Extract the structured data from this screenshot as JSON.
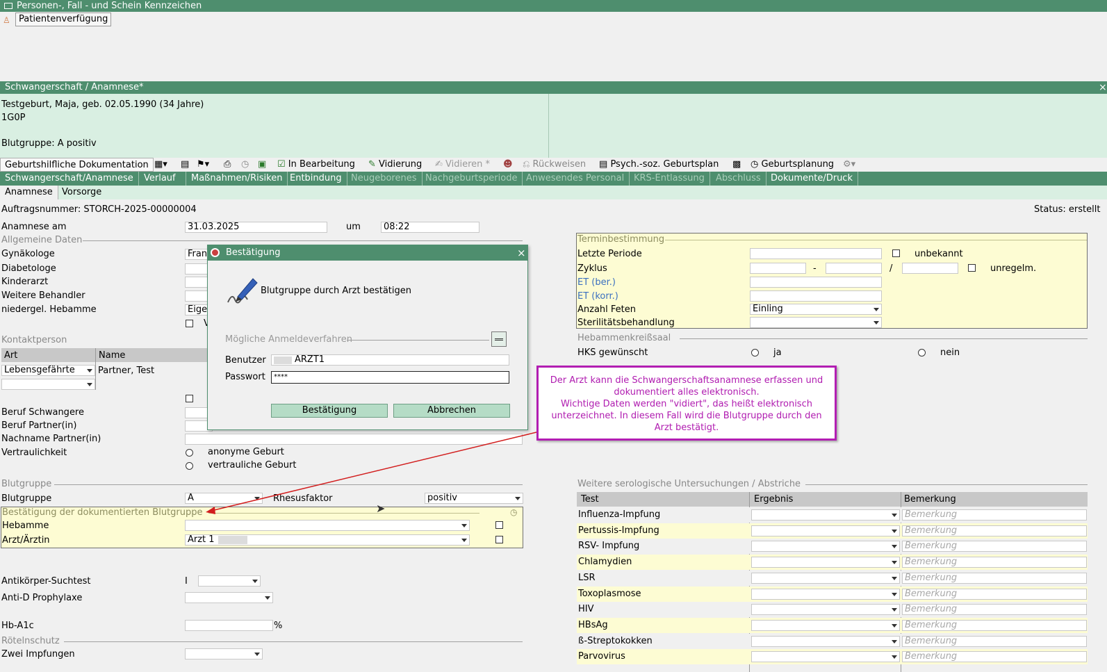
{
  "top_bar": {
    "title": "Personen-, Fall - und Schein Kennzeichen",
    "item": "Patientenverfügung"
  },
  "window": {
    "title": "Schwangerschaft / Anamnese*",
    "close": "×"
  },
  "patient": {
    "line1": "Testgeburt, Maja, geb. 02.05.1990 (34 Jahre)",
    "line2": "1G0P",
    "line3": "Blutgruppe: A positiv"
  },
  "toolbar": {
    "title": "Geburtshilfliche Dokumentation",
    "in_bearbeitung": "In Bearbeitung",
    "vidierung": "Vidierung",
    "vidieren": "Vidieren *",
    "rueckweisen": "Rückweisen",
    "psych": "Psych.-soz. Geburtsplan",
    "geburtsplanung": "Geburtsplanung"
  },
  "tabs": [
    "Schwangerschaft/Anamnese",
    "Verlauf",
    "Maßnahmen/Risiken",
    "Entbindung",
    "Neugeborenes",
    "Nachgeburtsperiode",
    "Anwesendes Personal",
    "KRS-Entlassung",
    "Abschluss",
    "Dokumente/Druck"
  ],
  "subtabs": [
    "Anamnese",
    "Vorsorge"
  ],
  "order": {
    "label": "Auftragsnummer: STORCH-2025-00000004",
    "status": "Status: erstellt"
  },
  "anamnese": {
    "label": "Anamnese am",
    "date": "31.03.2025",
    "um": "um",
    "time": "08:22"
  },
  "allgemein": {
    "title": "Allgemeine Daten",
    "gyn": "Gynäkologe",
    "gyn_val": "Fran",
    "diab": "Diabetologe",
    "kinder": "Kinderarzt",
    "weitere": "Weitere Behandler",
    "hebamme": "niedergel. Hebamme",
    "hebamme_val": "Eige",
    "v": "V"
  },
  "kontakt": {
    "title": "Kontaktperson",
    "col_art": "Art",
    "col_name": "Name",
    "art": "Lebensgefährte",
    "name": "Partner, Test"
  },
  "beruf": {
    "schwangere": "Beruf Schwangere",
    "partner": "Beruf Partner(in)",
    "nachname": "Nachname Partner(in)",
    "vertraulich": "Vertraulichkeit",
    "anonym": "anonyme Geburt",
    "vertraulich_geburt": "vertrauliche Geburt"
  },
  "blut": {
    "title": "Blutgruppe",
    "label": "Blutgruppe",
    "value": "A",
    "rh_label": "Rhesusfaktor",
    "rh_value": "positiv",
    "confirm_title": "Bestätigung der dokumentierten Blutgruppe",
    "hebamme": "Hebamme",
    "arzt": "Arzt/Ärztin",
    "arzt_val": "Arzt 1"
  },
  "other": {
    "antik": "Antikörper-Suchtest",
    "antik_prefix": "I",
    "antid": "Anti-D Prophylaxe",
    "hba1c": "Hb-A1c",
    "pct": "%",
    "roeteln": "Rötelnschutz",
    "zwei": "Zwei Impfungen"
  },
  "termin": {
    "title": "Terminbestimmung",
    "periode": "Letzte Periode",
    "unbekannt": "unbekannt",
    "zyklus": "Zyklus",
    "dash": "-",
    "slash": "/",
    "unregl": "unregelm.",
    "et_ber": "ET (ber.)",
    "et_korr": "ET (korr.)",
    "feten": "Anzahl Feten",
    "feten_val": "Einling",
    "steril": "Sterilitätsbehandlung"
  },
  "hks": {
    "title": "Hebammenkreißsaal",
    "label": "HKS gewünscht",
    "ja": "ja",
    "nein": "nein"
  },
  "sero": {
    "title": "Weitere serologische Untersuchungen / Abstriche",
    "col_test": "Test",
    "col_erg": "Ergebnis",
    "col_bem": "Bemerkung",
    "placeholder": "Bemerkung",
    "tests": [
      "Influenza-Impfung",
      "Pertussis-Impfung",
      "RSV- Impfung",
      "Chlamydien",
      "LSR",
      "Toxoplasmose",
      "HIV",
      "HBsAg",
      "ß-Streptokokken",
      "Parvovirus"
    ]
  },
  "dialog": {
    "title": "Bestätigung",
    "message": "Blutgruppe durch Arzt bestätigen",
    "methods": "Mögliche Anmeldeverfahren",
    "user_label": "Benutzer",
    "user_val": "ARZT1",
    "pw_label": "Passwort",
    "pw_val": "****",
    "ok": "Bestätigung",
    "cancel": "Abbrechen",
    "close": "×"
  },
  "note": {
    "text": "Der Arzt kann die Schwangerschaftsanamnese erfassen und dokumentiert alles elektronisch.\nWichtige Daten werden \"vidiert\", das heißt elektronisch unterzeichnet. In diesem Fall wird die Blutgruppe durch den Arzt bestätigt.",
    "color": "#b01cb0"
  }
}
